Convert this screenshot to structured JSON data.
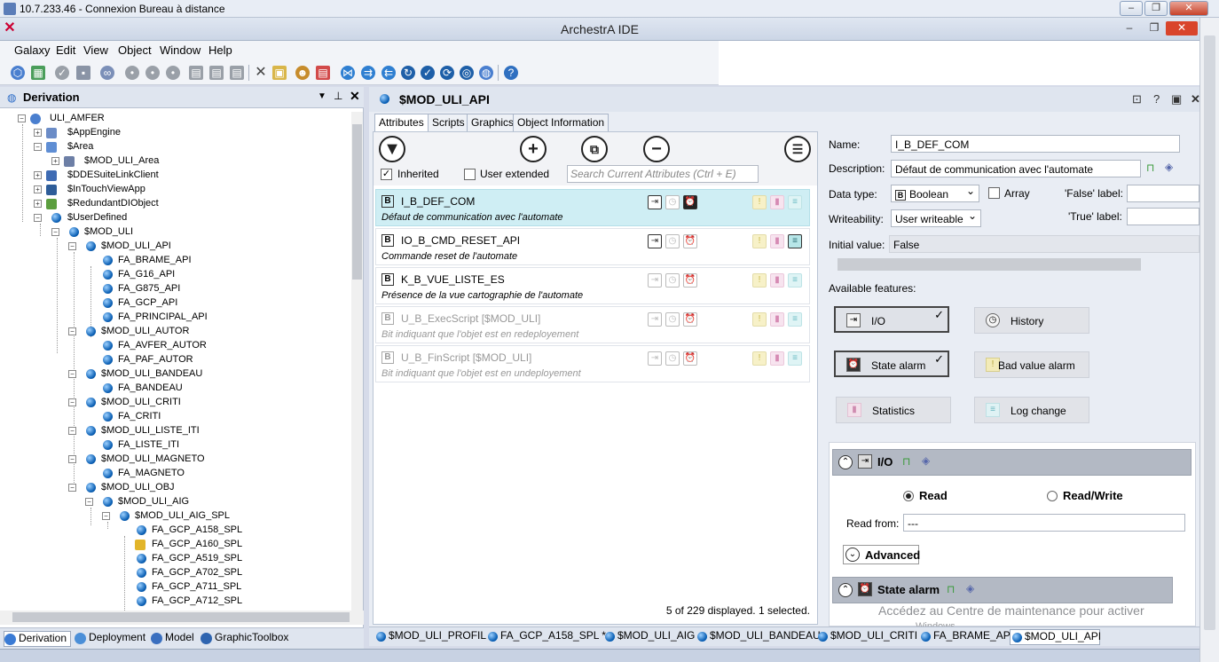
{
  "rdp": {
    "title": "10.7.233.46 - Connexion Bureau à distance"
  },
  "window": {
    "title": "ArchestrA IDE"
  },
  "menu": [
    "Galaxy",
    "Edit",
    "View",
    "Object",
    "Window",
    "Help"
  ],
  "left_panel": {
    "title": "Derivation",
    "tree": [
      {
        "label": "ULI_AMFER"
      },
      {
        "label": "$AppEngine"
      },
      {
        "label": "$Area"
      },
      {
        "label": "$MOD_ULI_Area"
      },
      {
        "label": "$DDESuiteLinkClient"
      },
      {
        "label": "$InTouchViewApp"
      },
      {
        "label": "$RedundantDIObject"
      },
      {
        "label": "$UserDefined"
      },
      {
        "label": "$MOD_ULI"
      },
      {
        "label": "$MOD_ULI_API"
      },
      {
        "label": "FA_BRAME_API"
      },
      {
        "label": "FA_G16_API"
      },
      {
        "label": "FA_G875_API"
      },
      {
        "label": "FA_GCP_API"
      },
      {
        "label": "FA_PRINCIPAL_API"
      },
      {
        "label": "$MOD_ULI_AUTOR"
      },
      {
        "label": "FA_AVFER_AUTOR"
      },
      {
        "label": "FA_PAF_AUTOR"
      },
      {
        "label": "$MOD_ULI_BANDEAU"
      },
      {
        "label": "FA_BANDEAU"
      },
      {
        "label": "$MOD_ULI_CRITI"
      },
      {
        "label": "FA_CRITI"
      },
      {
        "label": "$MOD_ULI_LISTE_ITI"
      },
      {
        "label": "FA_LISTE_ITI"
      },
      {
        "label": "$MOD_ULI_MAGNETO"
      },
      {
        "label": "FA_MAGNETO"
      },
      {
        "label": "$MOD_ULI_OBJ"
      },
      {
        "label": "$MOD_ULI_AIG"
      },
      {
        "label": "$MOD_ULI_AIG_SPL"
      },
      {
        "label": "FA_GCP_A158_SPL"
      },
      {
        "label": "FA_GCP_A160_SPL"
      },
      {
        "label": "FA_GCP_A519_SPL"
      },
      {
        "label": "FA_GCP_A702_SPL"
      },
      {
        "label": "FA_GCP_A711_SPL"
      },
      {
        "label": "FA_GCP_A712_SPL"
      }
    ],
    "tabs": [
      "Derivation",
      "Deployment",
      "Model",
      "GraphicToolbox"
    ]
  },
  "editor": {
    "title": "$MOD_ULI_API",
    "tabs": [
      "Attributes",
      "Scripts",
      "Graphics",
      "Object Information"
    ],
    "inherited_label": "Inherited",
    "user_extended_label": "User extended",
    "search_placeholder": "Search Current Attributes (Ctrl + E)",
    "attributes": [
      {
        "name": "I_B_DEF_COM",
        "desc": "Défaut de communication avec l'automate"
      },
      {
        "name": "IO_B_CMD_RESET_API",
        "desc": "Commande reset de l'automate"
      },
      {
        "name": "K_B_VUE_LISTE_ES",
        "desc": "Présence de la vue cartographie de l'automate"
      },
      {
        "name": "U_B_ExecScript [$MOD_ULI]",
        "desc": "Bit indiquant que l'objet est en redeployement"
      },
      {
        "name": "U_B_FinScript [$MOD_ULI]",
        "desc": "Bit indiquant que l'objet est en undeployement"
      }
    ],
    "status": "5 of 229 displayed. 1 selected."
  },
  "details": {
    "name_label": "Name:",
    "name": "I_B_DEF_COM",
    "desc_label": "Description:",
    "desc": "Défaut de communication avec l'automate",
    "datatype_label": "Data type:",
    "datatype": "Boolean",
    "array_label": "Array",
    "false_label": "'False' label:",
    "true_label": "'True' label:",
    "write_label": "Writeability:",
    "write": "User writeable",
    "init_label": "Initial value:",
    "init": "False",
    "features_label": "Available features:",
    "features": [
      "I/O",
      "History",
      "State alarm",
      "Bad value alarm",
      "Statistics",
      "Log change"
    ],
    "io_group": "I/O",
    "read": "Read",
    "readwrite": "Read/Write",
    "read_from_label": "Read from:",
    "read_from": "---",
    "advanced": "Advanced",
    "state_alarm_group": "State alarm"
  },
  "doc_tabs": [
    "$MOD_ULI_PROFIL",
    "FA_GCP_A158_SPL *",
    "$MOD_ULI_AIG",
    "$MOD_ULI_BANDEAU",
    "$MOD_ULI_CRITI",
    "FA_BRAME_API",
    "$MOD_ULI_API"
  ],
  "watermark": {
    "line1": "Accédez au Centre de maintenance pour activer",
    "line2": "Windows"
  }
}
